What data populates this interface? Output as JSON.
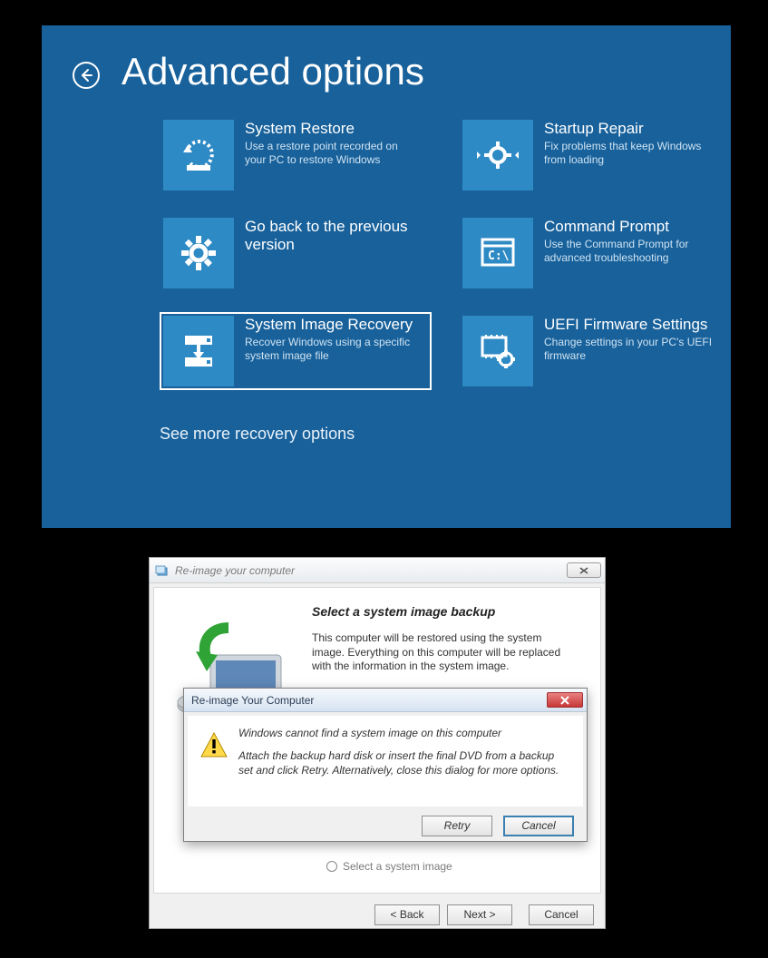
{
  "winre": {
    "title": "Advanced options",
    "see_more": "See more recovery options",
    "tiles": [
      {
        "title": "System Restore",
        "desc": "Use a restore point recorded on your PC to restore Windows"
      },
      {
        "title": "Startup Repair",
        "desc": "Fix problems that keep Windows from loading"
      },
      {
        "title": "Go back to the previous version",
        "desc": ""
      },
      {
        "title": "Command Prompt",
        "desc": "Use the Command Prompt for advanced troubleshooting"
      },
      {
        "title": "System Image Recovery",
        "desc": "Recover Windows using a specific system image file"
      },
      {
        "title": "UEFI Firmware Settings",
        "desc": "Change settings in your PC's UEFI firmware"
      }
    ]
  },
  "wizard": {
    "window_title": "Re-image your computer",
    "heading": "Select a system image backup",
    "paragraph": "This computer will be restored using the system image. Everything on this computer will be replaced with the information in the system image.",
    "radio_label": "Select a system image",
    "buttons": {
      "back": "< Back",
      "next": "Next >",
      "cancel": "Cancel"
    }
  },
  "error": {
    "title": "Re-image Your Computer",
    "line1": "Windows cannot find a system image on this computer",
    "line2": "Attach the backup hard disk or insert the final DVD from a backup set and click Retry. Alternatively, close this dialog for more options.",
    "retry": "Retry",
    "cancel": "Cancel"
  }
}
